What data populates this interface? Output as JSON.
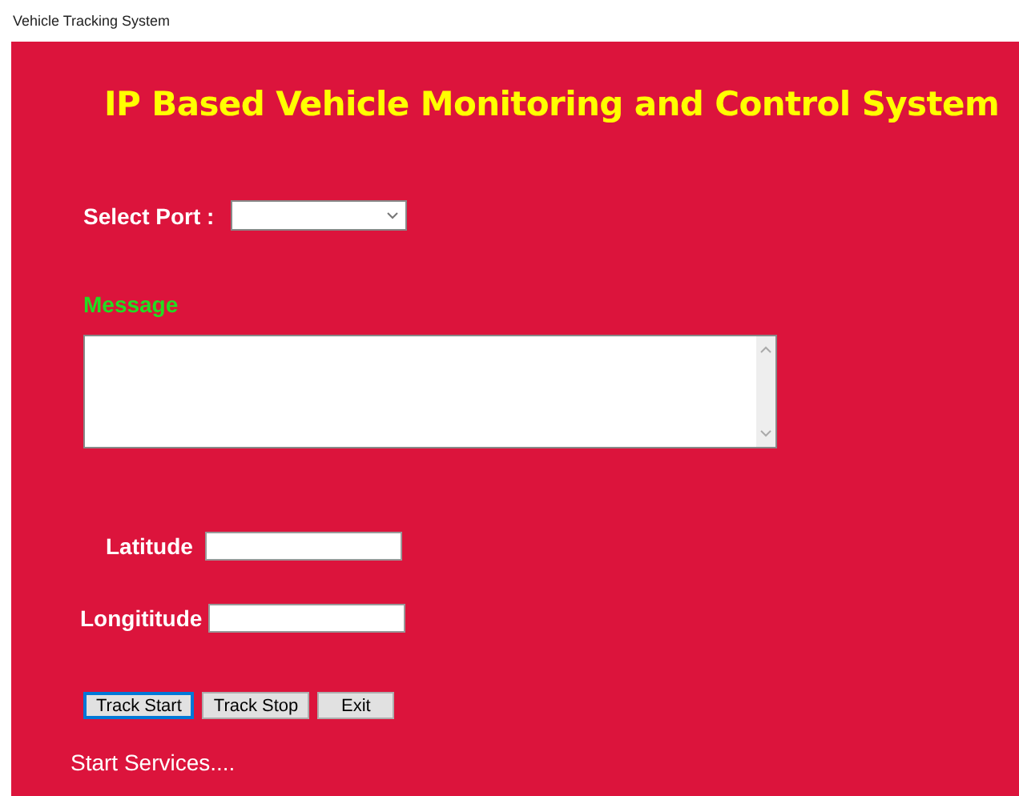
{
  "window": {
    "title": "Vehicle Tracking System"
  },
  "heading": "IP Based Vehicle Monitoring and Control System",
  "port": {
    "label": "Select Port :"
  },
  "message": {
    "label": "Message"
  },
  "latitude": {
    "label": "Latitude"
  },
  "longitude": {
    "label": "Longititude"
  },
  "buttons": [
    {
      "label": "Track Start",
      "focused": true
    },
    {
      "label": "Track Stop",
      "focused": false
    },
    {
      "label": "Exit",
      "focused": false
    }
  ],
  "status": "Start Services...."
}
